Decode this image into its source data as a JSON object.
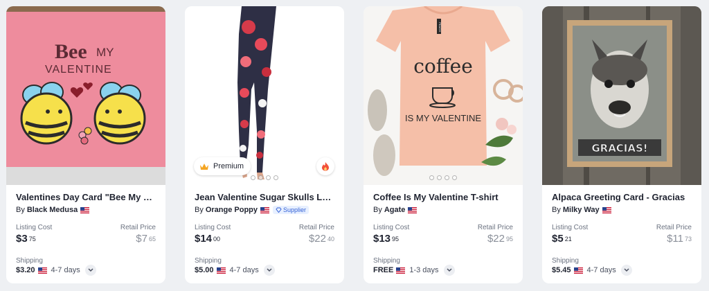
{
  "products": [
    {
      "title": "Valentines Day Card \"Bee My Valentine\"",
      "by_prefix": "By",
      "vendor": "Black Medusa",
      "listing_cost_label": "Listing Cost",
      "listing_cost_main": "$3",
      "listing_cost_cents": "75",
      "retail_label": "Retail Price",
      "retail_main": "$7",
      "retail_cents": "65",
      "shipping_label": "Shipping",
      "shipping_cost": "$3.20",
      "shipping_days": "4-7 days",
      "image_text": {
        "line1": "Bee",
        "line1b": "MY",
        "line2": "VALENTINE"
      }
    },
    {
      "title": "Jean Valentine Sugar Skulls Leggings",
      "by_prefix": "By",
      "vendor": "Orange Poppy",
      "supplier_label": "Supplier",
      "badge": "Premium",
      "listing_cost_label": "Listing Cost",
      "listing_cost_main": "$14",
      "listing_cost_cents": "00",
      "retail_label": "Retail Price",
      "retail_main": "$22",
      "retail_cents": "40",
      "shipping_label": "Shipping",
      "shipping_cost": "$5.00",
      "shipping_days": "4-7 days"
    },
    {
      "title": "Coffee Is My Valentine T-shirt",
      "by_prefix": "By",
      "vendor": "Agate",
      "listing_cost_label": "Listing Cost",
      "listing_cost_main": "$13",
      "listing_cost_cents": "95",
      "retail_label": "Retail Price",
      "retail_main": "$22",
      "retail_cents": "95",
      "shipping_label": "Shipping",
      "shipping_cost": "FREE",
      "shipping_days": "1-3 days",
      "image_text": {
        "line1": "coffee",
        "line2": "IS MY VALENTINE",
        "tag": "PEACH"
      }
    },
    {
      "title": "Alpaca Greeting Card - Gracias",
      "by_prefix": "By",
      "vendor": "Milky Way",
      "listing_cost_label": "Listing Cost",
      "listing_cost_main": "$5",
      "listing_cost_cents": "21",
      "retail_label": "Retail Price",
      "retail_main": "$11",
      "retail_cents": "73",
      "shipping_label": "Shipping",
      "shipping_cost": "$5.45",
      "shipping_days": "4-7 days",
      "image_text": {
        "caption": "GRACIAS!"
      }
    }
  ],
  "icons": {
    "flag": "us-flag-icon",
    "crown": "crown-icon",
    "fire": "fire-icon",
    "chevron": "chevron-down-icon",
    "diamond": "diamond-icon"
  },
  "colors": {
    "card_bg": "#ffffff",
    "page_bg": "#eef0f3",
    "muted": "#8a8f99",
    "supplier_blue": "#3562d6"
  }
}
